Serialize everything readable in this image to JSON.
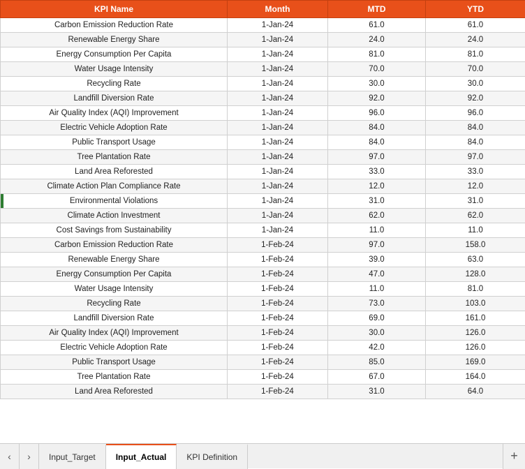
{
  "header": {
    "col1": "KPI Name",
    "col2": "Month",
    "col3": "MTD",
    "col4": "YTD"
  },
  "rows": [
    {
      "kpi": "Carbon Emission Reduction Rate",
      "month": "1-Jan-24",
      "mtd": "61.0",
      "ytd": "61.0"
    },
    {
      "kpi": "Renewable Energy Share",
      "month": "1-Jan-24",
      "mtd": "24.0",
      "ytd": "24.0"
    },
    {
      "kpi": "Energy Consumption Per Capita",
      "month": "1-Jan-24",
      "mtd": "81.0",
      "ytd": "81.0"
    },
    {
      "kpi": "Water Usage Intensity",
      "month": "1-Jan-24",
      "mtd": "70.0",
      "ytd": "70.0"
    },
    {
      "kpi": "Recycling Rate",
      "month": "1-Jan-24",
      "mtd": "30.0",
      "ytd": "30.0"
    },
    {
      "kpi": "Landfill Diversion Rate",
      "month": "1-Jan-24",
      "mtd": "92.0",
      "ytd": "92.0"
    },
    {
      "kpi": "Air Quality Index (AQI) Improvement",
      "month": "1-Jan-24",
      "mtd": "96.0",
      "ytd": "96.0"
    },
    {
      "kpi": "Electric Vehicle Adoption Rate",
      "month": "1-Jan-24",
      "mtd": "84.0",
      "ytd": "84.0"
    },
    {
      "kpi": "Public Transport Usage",
      "month": "1-Jan-24",
      "mtd": "84.0",
      "ytd": "84.0"
    },
    {
      "kpi": "Tree Plantation Rate",
      "month": "1-Jan-24",
      "mtd": "97.0",
      "ytd": "97.0"
    },
    {
      "kpi": "Land Area Reforested",
      "month": "1-Jan-24",
      "mtd": "33.0",
      "ytd": "33.0"
    },
    {
      "kpi": "Climate Action Plan Compliance Rate",
      "month": "1-Jan-24",
      "mtd": "12.0",
      "ytd": "12.0"
    },
    {
      "kpi": "Environmental Violations",
      "month": "1-Jan-24",
      "mtd": "31.0",
      "ytd": "31.0",
      "bar": true
    },
    {
      "kpi": "Climate Action Investment",
      "month": "1-Jan-24",
      "mtd": "62.0",
      "ytd": "62.0"
    },
    {
      "kpi": "Cost Savings from Sustainability",
      "month": "1-Jan-24",
      "mtd": "11.0",
      "ytd": "11.0"
    },
    {
      "kpi": "Carbon Emission Reduction Rate",
      "month": "1-Feb-24",
      "mtd": "97.0",
      "ytd": "158.0"
    },
    {
      "kpi": "Renewable Energy Share",
      "month": "1-Feb-24",
      "mtd": "39.0",
      "ytd": "63.0"
    },
    {
      "kpi": "Energy Consumption Per Capita",
      "month": "1-Feb-24",
      "mtd": "47.0",
      "ytd": "128.0"
    },
    {
      "kpi": "Water Usage Intensity",
      "month": "1-Feb-24",
      "mtd": "11.0",
      "ytd": "81.0"
    },
    {
      "kpi": "Recycling Rate",
      "month": "1-Feb-24",
      "mtd": "73.0",
      "ytd": "103.0"
    },
    {
      "kpi": "Landfill Diversion Rate",
      "month": "1-Feb-24",
      "mtd": "69.0",
      "ytd": "161.0"
    },
    {
      "kpi": "Air Quality Index (AQI) Improvement",
      "month": "1-Feb-24",
      "mtd": "30.0",
      "ytd": "126.0"
    },
    {
      "kpi": "Electric Vehicle Adoption Rate",
      "month": "1-Feb-24",
      "mtd": "42.0",
      "ytd": "126.0"
    },
    {
      "kpi": "Public Transport Usage",
      "month": "1-Feb-24",
      "mtd": "85.0",
      "ytd": "169.0"
    },
    {
      "kpi": "Tree Plantation Rate",
      "month": "1-Feb-24",
      "mtd": "67.0",
      "ytd": "164.0"
    },
    {
      "kpi": "Land Area Reforested",
      "month": "1-Feb-24",
      "mtd": "31.0",
      "ytd": "64.0"
    }
  ],
  "tabs": [
    {
      "label": "Input_Target",
      "active": false
    },
    {
      "label": "Input_Actual",
      "active": true
    },
    {
      "label": "KPI Definition",
      "active": false
    }
  ],
  "tab_add_label": "+",
  "arrow_left": "‹",
  "arrow_right": "›"
}
